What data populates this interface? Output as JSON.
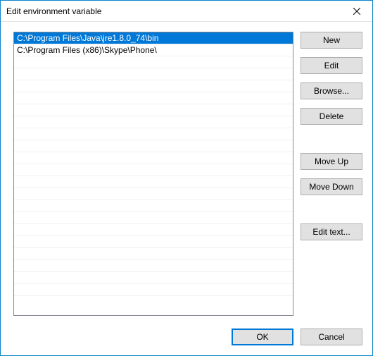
{
  "window": {
    "title": "Edit environment variable"
  },
  "list": {
    "items": [
      "C:\\Program Files\\Java\\jre1.8.0_74\\bin",
      "C:\\Program Files (x86)\\Skype\\Phone\\"
    ],
    "selected_index": 0
  },
  "buttons": {
    "new": "New",
    "edit": "Edit",
    "browse": "Browse...",
    "delete": "Delete",
    "move_up": "Move Up",
    "move_down": "Move Down",
    "edit_text": "Edit text...",
    "ok": "OK",
    "cancel": "Cancel"
  }
}
